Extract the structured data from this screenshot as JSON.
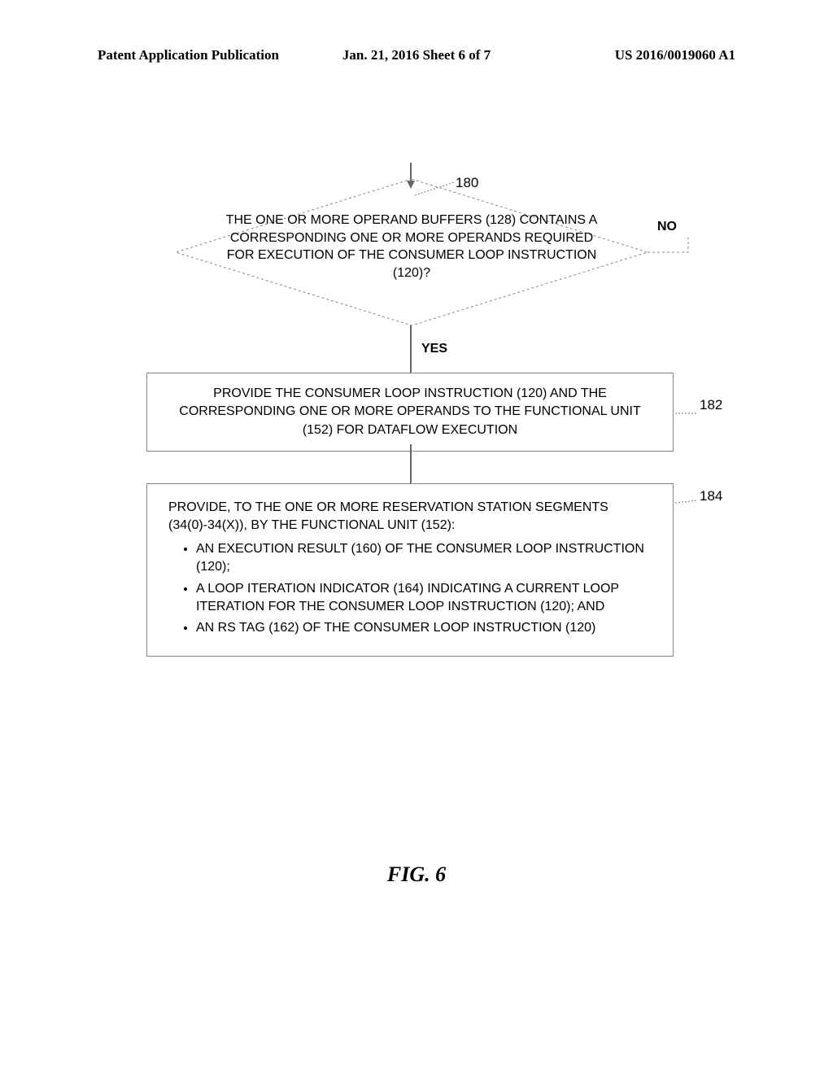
{
  "header": {
    "left": "Patent Application Publication",
    "center": "Jan. 21, 2016  Sheet 6 of 7",
    "right": "US 2016/0019060 A1"
  },
  "refs": {
    "r180": "180",
    "r182": "182",
    "r184": "184"
  },
  "labels": {
    "yes": "YES",
    "no": "NO"
  },
  "decision": "THE ONE OR MORE OPERAND BUFFERS (128) CONTAINS A CORRESPONDING ONE OR MORE OPERANDS REQUIRED FOR EXECUTION OF THE CONSUMER LOOP INSTRUCTION (120)?",
  "box182": "PROVIDE THE CONSUMER LOOP INSTRUCTION (120) AND THE CORRESPONDING ONE OR MORE OPERANDS TO THE FUNCTIONAL UNIT (152) FOR DATAFLOW EXECUTION",
  "box184_intro": "PROVIDE, TO THE ONE OR MORE RESERVATION STATION SEGMENTS (34(0)-34(X)), BY THE FUNCTIONAL UNIT (152):",
  "box184_b1": "AN EXECUTION RESULT (160) OF THE CONSUMER LOOP INSTRUCTION (120);",
  "box184_b2": "A LOOP ITERATION INDICATOR (164) INDICATING A CURRENT LOOP ITERATION FOR THE CONSUMER LOOP INSTRUCTION (120); AND",
  "box184_b3": "AN RS TAG (162) OF THE CONSUMER LOOP INSTRUCTION (120)",
  "figure": "FIG. 6",
  "chart_data": {
    "type": "flowchart",
    "nodes": [
      {
        "id": 180,
        "kind": "decision",
        "text": "THE ONE OR MORE OPERAND BUFFERS (128) CONTAINS A CORRESPONDING ONE OR MORE OPERANDS REQUIRED FOR EXECUTION OF THE CONSUMER LOOP INSTRUCTION (120)?"
      },
      {
        "id": 182,
        "kind": "process",
        "text": "PROVIDE THE CONSUMER LOOP INSTRUCTION (120) AND THE CORRESPONDING ONE OR MORE OPERANDS TO THE FUNCTIONAL UNIT (152) FOR DATAFLOW EXECUTION"
      },
      {
        "id": 184,
        "kind": "process",
        "text": "PROVIDE, TO THE ONE OR MORE RESERVATION STATION SEGMENTS (34(0)-34(X)), BY THE FUNCTIONAL UNIT (152): AN EXECUTION RESULT (160) OF THE CONSUMER LOOP INSTRUCTION (120); A LOOP ITERATION INDICATOR (164) INDICATING A CURRENT LOOP ITERATION FOR THE CONSUMER LOOP INSTRUCTION (120); AND AN RS TAG (162) OF THE CONSUMER LOOP INSTRUCTION (120)"
      }
    ],
    "edges": [
      {
        "from": "entry",
        "to": 180
      },
      {
        "from": 180,
        "to": 182,
        "label": "YES"
      },
      {
        "from": 180,
        "to": "loopback_entry",
        "label": "NO"
      },
      {
        "from": 182,
        "to": 184
      }
    ]
  }
}
